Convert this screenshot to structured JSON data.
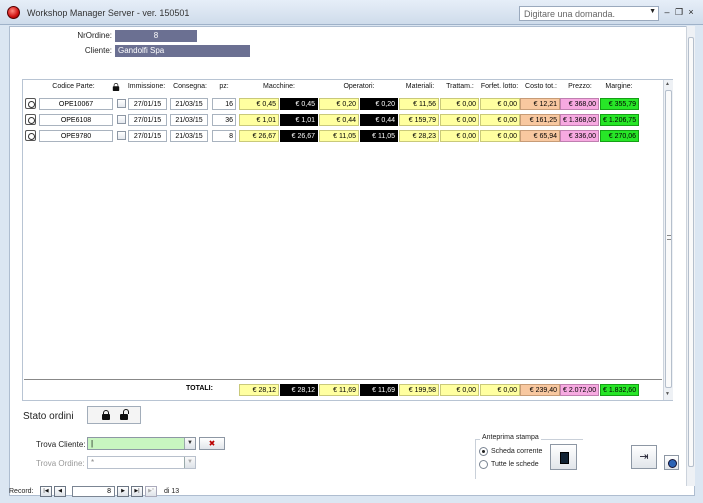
{
  "window": {
    "title": "Workshop Manager Server - ver. 150501",
    "help_placeholder": "Digitare una domanda.",
    "minimize": "–",
    "restore": "❐",
    "close": "×"
  },
  "header": {
    "nr_ordine_label": "NrOrdine:",
    "nr_ordine_value": "8",
    "cliente_label": "Cliente:",
    "cliente_value": "Gandolfi Spa"
  },
  "grid": {
    "columns": {
      "codice": "Codice Parte:",
      "immissione": "Immissione:",
      "consegna": "Consegna:",
      "pz": "pz:",
      "macchine": "Macchine:",
      "operatori": "Operatori:",
      "materiali": "Materiali:",
      "trattam": "Trattam.:",
      "forfet": "Forfet. lotto:",
      "costo": "Costo tot.:",
      "prezzo": "Prezzo:",
      "margine": "Margine:"
    },
    "rows": [
      {
        "codice": "OPE10067",
        "immissione": "27/01/15",
        "consegna": "21/03/15",
        "pz": "16",
        "macchine1": "€ 0,45",
        "macchine2": "€ 0,45",
        "operatori1": "€ 0,20",
        "operatori2": "€ 0,20",
        "materiali": "€ 11,56",
        "trattam": "€ 0,00",
        "forfet": "€ 0,00",
        "costo": "€ 12,21",
        "prezzo": "€ 368,00",
        "margine": "€ 355,79"
      },
      {
        "codice": "OPE6108",
        "immissione": "27/01/15",
        "consegna": "21/03/15",
        "pz": "36",
        "macchine1": "€ 1,01",
        "macchine2": "€ 1,01",
        "operatori1": "€ 0,44",
        "operatori2": "€ 0,44",
        "materiali": "€ 159,79",
        "trattam": "€ 0,00",
        "forfet": "€ 0,00",
        "costo": "€ 161,25",
        "prezzo": "€ 1.368,00",
        "margine": "€ 1.206,75"
      },
      {
        "codice": "OPE9780",
        "immissione": "27/01/15",
        "consegna": "21/03/15",
        "pz": "8",
        "macchine1": "€ 26,67",
        "macchine2": "€ 26,67",
        "operatori1": "€ 11,05",
        "operatori2": "€ 11,05",
        "materiali": "€ 28,23",
        "trattam": "€ 0,00",
        "forfet": "€ 0,00",
        "costo": "€ 65,94",
        "prezzo": "€ 336,00",
        "margine": "€ 270,06"
      }
    ],
    "totals": {
      "label": "TOTALI:",
      "macchine1": "€ 28,12",
      "macchine2": "€ 28,12",
      "operatori1": "€ 11,69",
      "operatori2": "€ 11,69",
      "materiali": "€ 199,58",
      "trattam": "€ 0,00",
      "forfet": "€ 0,00",
      "costo": "€ 239,40",
      "prezzo": "€ 2.072,00",
      "margine": "€ 1.832,60"
    }
  },
  "bottom": {
    "stato_label": "Stato ordini",
    "trova_cliente_label": "Trova Cliente:",
    "trova_cliente_value": "|",
    "trova_ordine_label": "Trova Ordine:",
    "trova_ordine_value": "*",
    "clear_label": "✖",
    "anteprima_label": "Anteprima stampa",
    "scheda_corrente": "Scheda corrente",
    "tutte_schede": "Tutte le schede"
  },
  "navigator": {
    "record_label": "Record:",
    "current": "8",
    "of_label": "di 13"
  },
  "colors": {
    "yellow": "#ffffa0",
    "black": "#000000",
    "salmon": "#f8c8a0",
    "pink": "#f7a9e1",
    "green": "#27e627",
    "header_value": "#6b7092",
    "find_field": "#c8f5c0"
  }
}
